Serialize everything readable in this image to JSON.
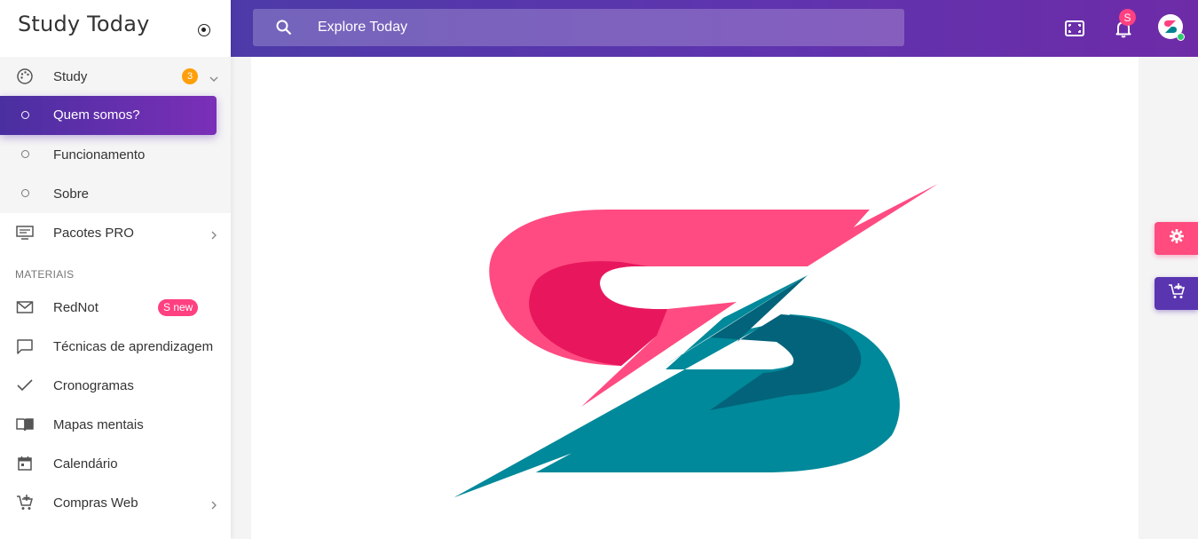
{
  "app": {
    "title": "Study Today"
  },
  "search": {
    "placeholder": "Explore Today"
  },
  "topbar": {
    "notification_count": "S",
    "avatar_letter": "S"
  },
  "sidebar": {
    "items": [
      {
        "label": "Study",
        "icon": "palette-icon",
        "badge": "3"
      },
      {
        "label": "Quem somos?",
        "active": true
      },
      {
        "label": "Funcionamento"
      },
      {
        "label": "Sobre"
      },
      {
        "label": "Pacotes PRO",
        "icon": "desktop-icon"
      }
    ],
    "section_title": "MATERIAIS",
    "materials": [
      {
        "label": "RedNot",
        "icon": "mail-icon",
        "badge": "S new"
      },
      {
        "label": "Técnicas de aprendizagem",
        "icon": "chat-icon"
      },
      {
        "label": "Cronogramas",
        "icon": "check-icon"
      },
      {
        "label": "Mapas mentais",
        "icon": "book-icon"
      },
      {
        "label": "Calendário",
        "icon": "calendar-icon"
      },
      {
        "label": "Compras Web",
        "icon": "cart-icon"
      }
    ]
  },
  "colors": {
    "accent_purple": "#5f34ae",
    "brand_pink": "#ff4081",
    "brand_teal": "#00838f",
    "badge_orange": "#ff9f0a"
  }
}
